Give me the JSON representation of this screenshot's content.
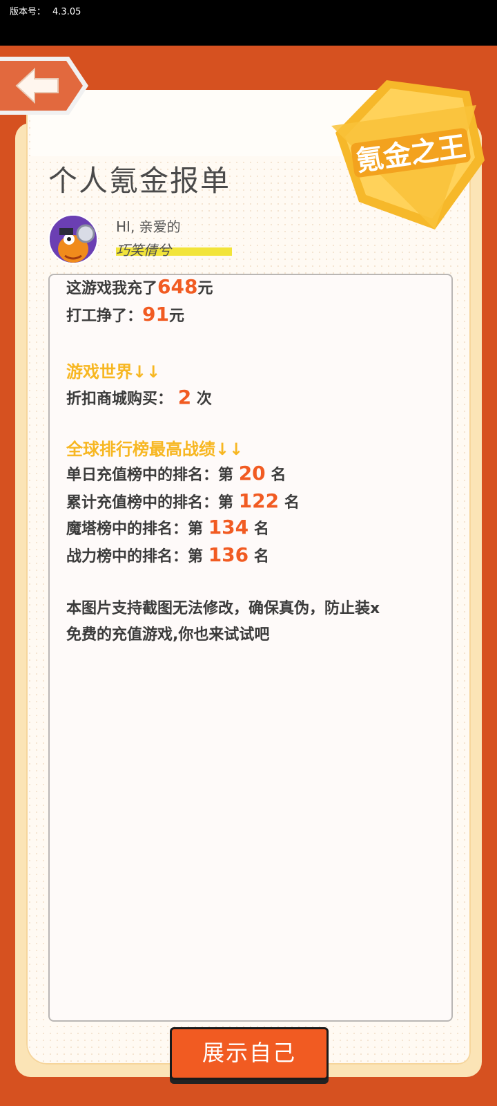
{
  "status": {
    "version_label": "版本号：",
    "version_value": "4.3.05"
  },
  "header": {
    "title": "个人氪金报单",
    "badge_text": "氪金之王"
  },
  "user": {
    "greeting": "HI, 亲爱的",
    "name": "巧笑倩兮"
  },
  "report": {
    "recharge_prefix": "这游戏我充了",
    "recharge_value": "648",
    "recharge_suffix": "元",
    "earn_prefix": "打工挣了：",
    "earn_value": "91",
    "earn_suffix": "元",
    "game_world_title": "游戏世界↓↓",
    "shop_prefix": "折扣商城购买：",
    "shop_value": "2",
    "shop_suffix": "次",
    "ranking_title": "全球排行榜最高战绩↓↓",
    "daily_prefix": "单日充值榜中的排名：第",
    "daily_value": "20",
    "daily_suffix": "名",
    "total_prefix": "累计充值榜中的排名：第",
    "total_value": "122",
    "total_suffix": "名",
    "tower_prefix": "魔塔榜中的排名：第",
    "tower_value": "134",
    "tower_suffix": "名",
    "power_prefix": "战力榜中的排名：第",
    "power_value": "136",
    "power_suffix": "名",
    "note_line1": "本图片支持截图无法修改，确保真伪，防止装x",
    "note_line2": "免费的充值游戏,你也来试试吧"
  },
  "actions": {
    "show_button": "展示自己"
  },
  "colors": {
    "accent": "#f15b22",
    "frame": "#d65120",
    "section": "#f7b722"
  }
}
